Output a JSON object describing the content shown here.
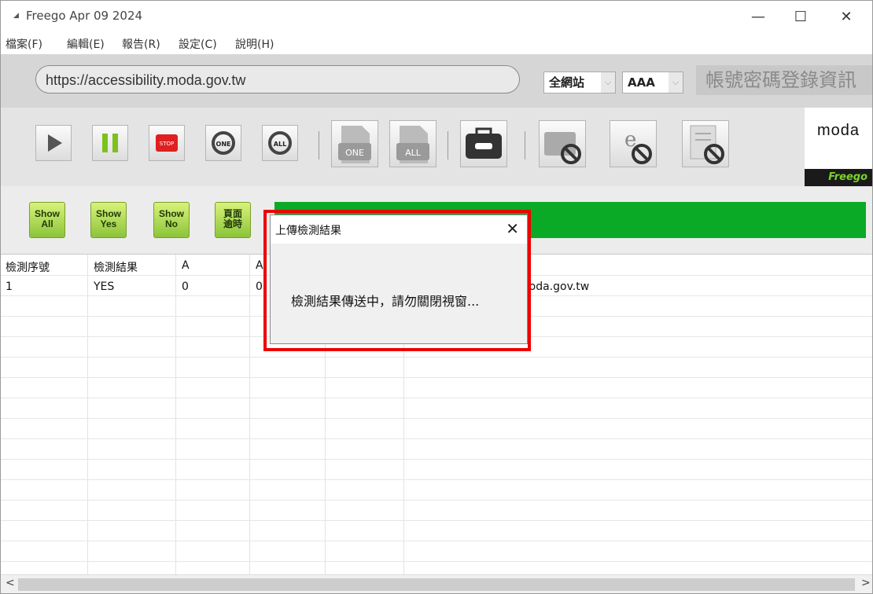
{
  "window": {
    "title": "Freego Apr 09 2024",
    "app_icon": "moda-icon",
    "controls": {
      "minimize": "—",
      "maximize": "☐",
      "close": "✕"
    }
  },
  "menu": [
    "檔案(F)",
    "編輯(E)",
    "報告(R)",
    "設定(C)",
    "說明(H)"
  ],
  "urlbar": {
    "url": "https://accessibility.moda.gov.tw",
    "scope": "全網站",
    "level": "AAA",
    "login_text": "帳號密碼登錄資訊"
  },
  "toolbar": {
    "buttons": [
      "play-icon",
      "pause-icon",
      "stop-icon",
      "refresh-one-icon",
      "refresh-all-icon",
      "report-one-icon",
      "report-all-icon",
      "toolbox-icon",
      "folder-block-icon",
      "browser-block-icon",
      "document-block-icon"
    ],
    "one_label": "ONE",
    "all_label": "ALL",
    "stop_label": "STOP"
  },
  "logo": {
    "name": "moda",
    "sub": "Freego"
  },
  "filters": {
    "show_all": [
      "Show",
      "All"
    ],
    "show_yes": [
      "Show",
      "Yes"
    ],
    "show_no": [
      "Show",
      "No"
    ],
    "timeout": [
      "頁面",
      "逾時"
    ]
  },
  "progress_color": "#0aaa26",
  "table": {
    "headers": [
      "檢測序號",
      "檢測結果",
      "A",
      "A"
    ],
    "rows": [
      [
        "1",
        "YES",
        "0",
        "0",
        "moda.gov.tw"
      ]
    ]
  },
  "dialog": {
    "title": "上傳檢測結果",
    "close": "✕",
    "message": "檢測結果傳送中，請勿關閉視窗..."
  },
  "scrollbar": {
    "left": "<",
    "right": ">"
  }
}
